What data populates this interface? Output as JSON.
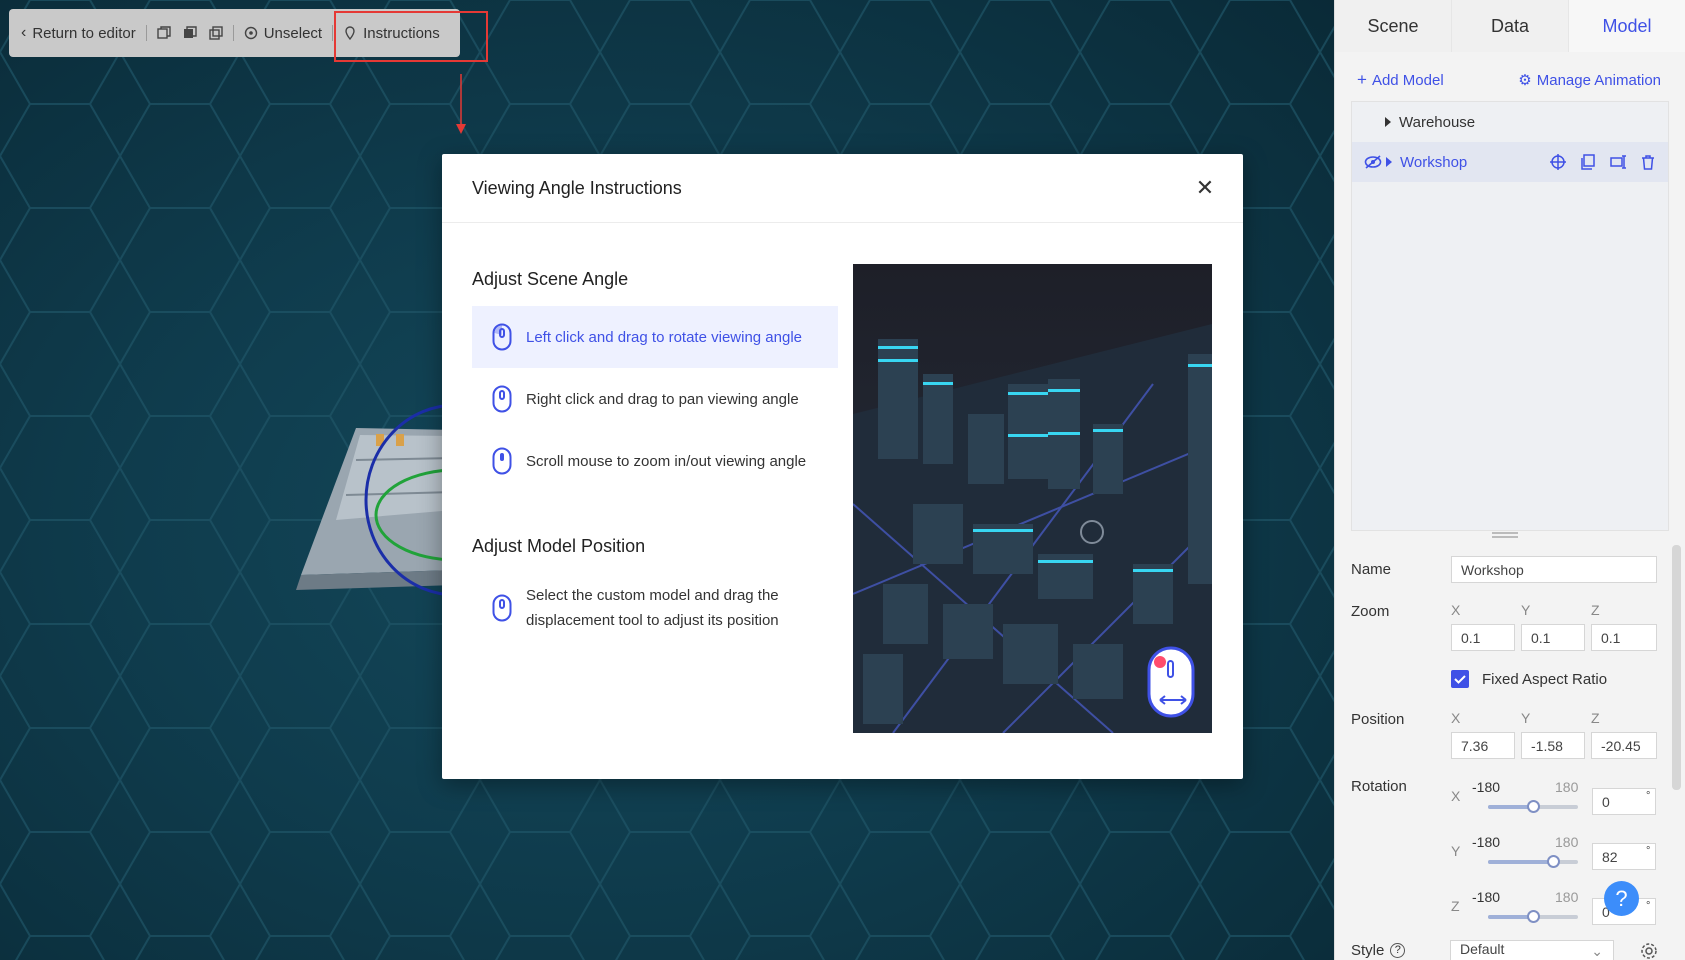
{
  "toolbar": {
    "return_label": "Return to editor",
    "unselect_label": "Unselect",
    "instructions_label": "Instructions"
  },
  "modal": {
    "title": "Viewing Angle Instructions",
    "section_scene": "Adjust Scene Angle",
    "section_model": "Adjust Model Position",
    "items": [
      {
        "text": "Left click and drag to rotate viewing angle"
      },
      {
        "text": "Right click and drag to pan viewing angle"
      },
      {
        "text": "Scroll mouse to zoom in/out viewing angle"
      },
      {
        "text_line1": "Select the custom model and drag the",
        "text_line2": "displacement tool to adjust its position"
      }
    ]
  },
  "panel": {
    "tabs": [
      {
        "label": "Scene"
      },
      {
        "label": "Data"
      },
      {
        "label": "Model"
      }
    ],
    "active_tab": "Model",
    "add_model": "Add Model",
    "manage_animation": "Manage Animation",
    "tree": [
      {
        "label": "Warehouse"
      },
      {
        "label": "Workshop"
      }
    ],
    "name_label": "Name",
    "name_value": "Workshop",
    "zoom_label": "Zoom",
    "zoom": {
      "x": "0.1",
      "y": "0.1",
      "z": "0.1"
    },
    "fixed_ratio_label": "Fixed Aspect Ratio",
    "position_label": "Position",
    "position": {
      "x": "7.36",
      "y": "-1.58",
      "z": "-20.45"
    },
    "rotation_label": "Rotation",
    "rotation": [
      {
        "axis": "X",
        "min": "-180",
        "max": "180",
        "value": "0"
      },
      {
        "axis": "Y",
        "min": "-180",
        "max": "180",
        "value": "82"
      },
      {
        "axis": "Z",
        "min": "-180",
        "max": "180",
        "value": "0"
      }
    ],
    "axis_labels": {
      "x": "X",
      "y": "Y",
      "z": "Z"
    },
    "style_label": "Style",
    "style_value": "Default",
    "degree_symbol": "°",
    "help_symbol": "?"
  },
  "colors": {
    "accent": "#3f51e6",
    "highlight": "#e53935",
    "help": "#3c8dfa"
  }
}
